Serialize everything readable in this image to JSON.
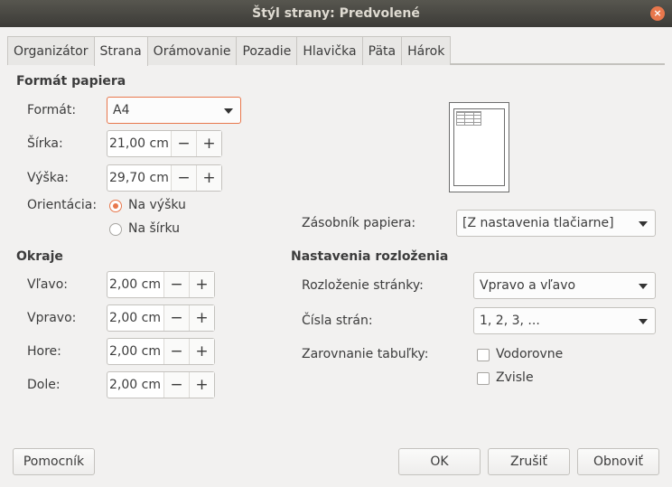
{
  "window": {
    "title": "Štýl strany: Predvolené"
  },
  "tabs": [
    {
      "label": "Organizátor"
    },
    {
      "label": "Strana"
    },
    {
      "label": "Orámovanie"
    },
    {
      "label": "Pozadie"
    },
    {
      "label": "Hlavička"
    },
    {
      "label": "Päta"
    },
    {
      "label": "Hárok"
    }
  ],
  "paper_format": {
    "title": "Formát papiera",
    "format_label": "Formát:",
    "format_value": "A4",
    "width_label": "Šírka:",
    "width_value": "21,00 cm",
    "height_label": "Výška:",
    "height_value": "29,70 cm",
    "orientation_label": "Orientácia:",
    "portrait_label": "Na výšku",
    "landscape_label": "Na šírku",
    "paper_tray_label": "Zásobník papiera:",
    "paper_tray_value": "[Z nastavenia tlačiarne]"
  },
  "margins": {
    "title": "Okraje",
    "left_label": "Vľavo:",
    "left_value": "2,00 cm",
    "right_label": "Vpravo:",
    "right_value": "2,00 cm",
    "top_label": "Hore:",
    "top_value": "2,00 cm",
    "bottom_label": "Dole:",
    "bottom_value": "2,00 cm"
  },
  "layout": {
    "title": "Nastavenia rozloženia",
    "page_layout_label": "Rozloženie stránky:",
    "page_layout_value": "Vpravo a vľavo",
    "page_numbers_label": "Čísla strán:",
    "page_numbers_value": "1, 2, 3, ...",
    "table_align_label": "Zarovnanie tabuľky:",
    "horizontal_label": "Vodorovne",
    "vertical_label": "Zvisle"
  },
  "buttons": {
    "help": "Pomocník",
    "ok": "OK",
    "cancel": "Zrušiť",
    "reset": "Obnoviť"
  },
  "spinner_symbols": {
    "minus": "−",
    "plus": "+"
  },
  "close_symbol": "×",
  "colors": {
    "accent": "#e8774c",
    "titlebar": "#3c3b37"
  }
}
